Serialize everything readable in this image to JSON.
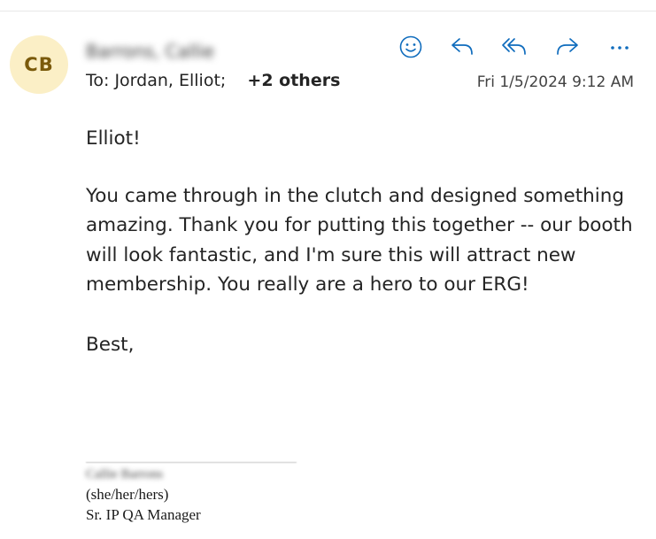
{
  "message": {
    "sender": {
      "initials": "CB",
      "name": "Barrons, Callie"
    },
    "recipients": {
      "prefix": "To:",
      "names": "Jordan, Elliot;",
      "others": "+2 others"
    },
    "date": "Fri 1/5/2024 9:12 AM",
    "actions": [
      {
        "name": "emoji-react",
        "icon": "smile-icon"
      },
      {
        "name": "reply",
        "icon": "reply-icon"
      },
      {
        "name": "reply-all",
        "icon": "reply-all-icon"
      },
      {
        "name": "forward",
        "icon": "forward-icon"
      },
      {
        "name": "more-actions",
        "icon": "ellipsis-icon"
      }
    ],
    "body": {
      "greeting": "Elliot!",
      "text": "You came through in the clutch and designed something amazing. Thank you for putting this together -- our booth will look fantastic, and I'm sure this will attract new membership. You really are a hero to our ERG!",
      "closing": "Best,"
    },
    "signature": {
      "name": "Callie Barrons",
      "pronouns": "(she/her/hers)",
      "title": "Sr. IP QA Manager"
    }
  },
  "colors": {
    "accent": "#0f6cbd",
    "avatar_bg": "#fbefc6",
    "avatar_text": "#7a5a0b"
  }
}
